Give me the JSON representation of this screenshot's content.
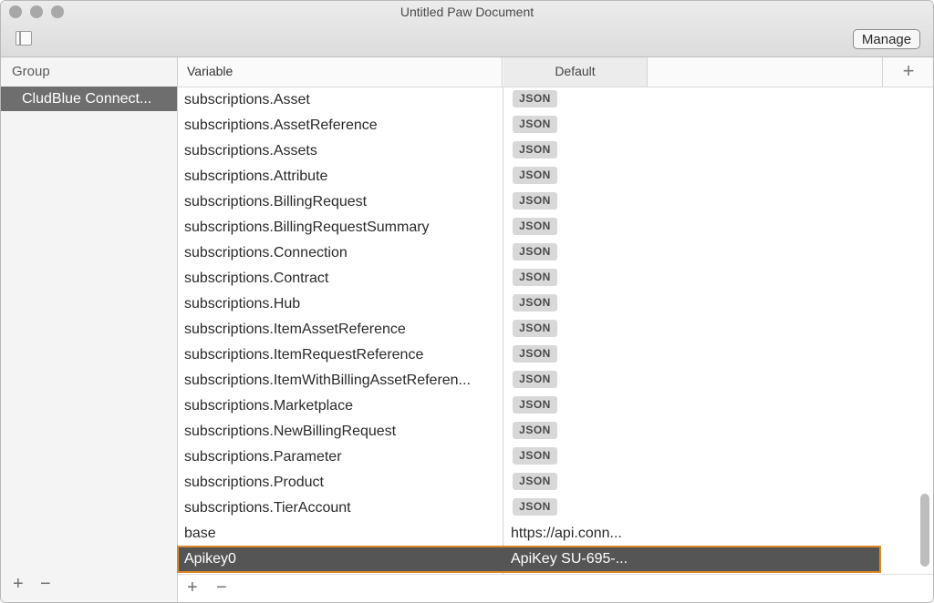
{
  "window": {
    "title": "Untitled Paw Document",
    "manage_label": "Manage"
  },
  "groups": {
    "header": "Group",
    "items": [
      {
        "label": "CludBlue Connect..."
      }
    ],
    "add_icon": "+",
    "remove_icon": "−"
  },
  "table": {
    "variable_header": "Variable",
    "default_header": "Default",
    "add_column_icon": "+",
    "rows": [
      {
        "variable": "subscriptions.Asset",
        "default": "JSON",
        "type": "json"
      },
      {
        "variable": "subscriptions.AssetReference",
        "default": "JSON",
        "type": "json"
      },
      {
        "variable": "subscriptions.Assets",
        "default": "JSON",
        "type": "json"
      },
      {
        "variable": "subscriptions.Attribute",
        "default": "JSON",
        "type": "json"
      },
      {
        "variable": "subscriptions.BillingRequest",
        "default": "JSON",
        "type": "json"
      },
      {
        "variable": "subscriptions.BillingRequestSummary",
        "default": "JSON",
        "type": "json"
      },
      {
        "variable": "subscriptions.Connection",
        "default": "JSON",
        "type": "json"
      },
      {
        "variable": "subscriptions.Contract",
        "default": "JSON",
        "type": "json"
      },
      {
        "variable": "subscriptions.Hub",
        "default": "JSON",
        "type": "json"
      },
      {
        "variable": "subscriptions.ItemAssetReference",
        "default": "JSON",
        "type": "json"
      },
      {
        "variable": "subscriptions.ItemRequestReference",
        "default": "JSON",
        "type": "json"
      },
      {
        "variable": "subscriptions.ItemWithBillingAssetReferen...",
        "default": "JSON",
        "type": "json"
      },
      {
        "variable": "subscriptions.Marketplace",
        "default": "JSON",
        "type": "json"
      },
      {
        "variable": "subscriptions.NewBillingRequest",
        "default": "JSON",
        "type": "json"
      },
      {
        "variable": "subscriptions.Parameter",
        "default": "JSON",
        "type": "json"
      },
      {
        "variable": "subscriptions.Product",
        "default": "JSON",
        "type": "json"
      },
      {
        "variable": "subscriptions.TierAccount",
        "default": "JSON",
        "type": "json"
      },
      {
        "variable": "base",
        "default": "https://api.conn...",
        "type": "text"
      },
      {
        "variable": "Apikey0",
        "default": "ApiKey SU-695-...",
        "type": "text",
        "selected": true
      }
    ],
    "add_icon": "+",
    "remove_icon": "−"
  },
  "colors": {
    "selection_bg": "#555555",
    "selection_outline": "#d98a2a",
    "group_selected_bg": "#6e6e6e"
  }
}
